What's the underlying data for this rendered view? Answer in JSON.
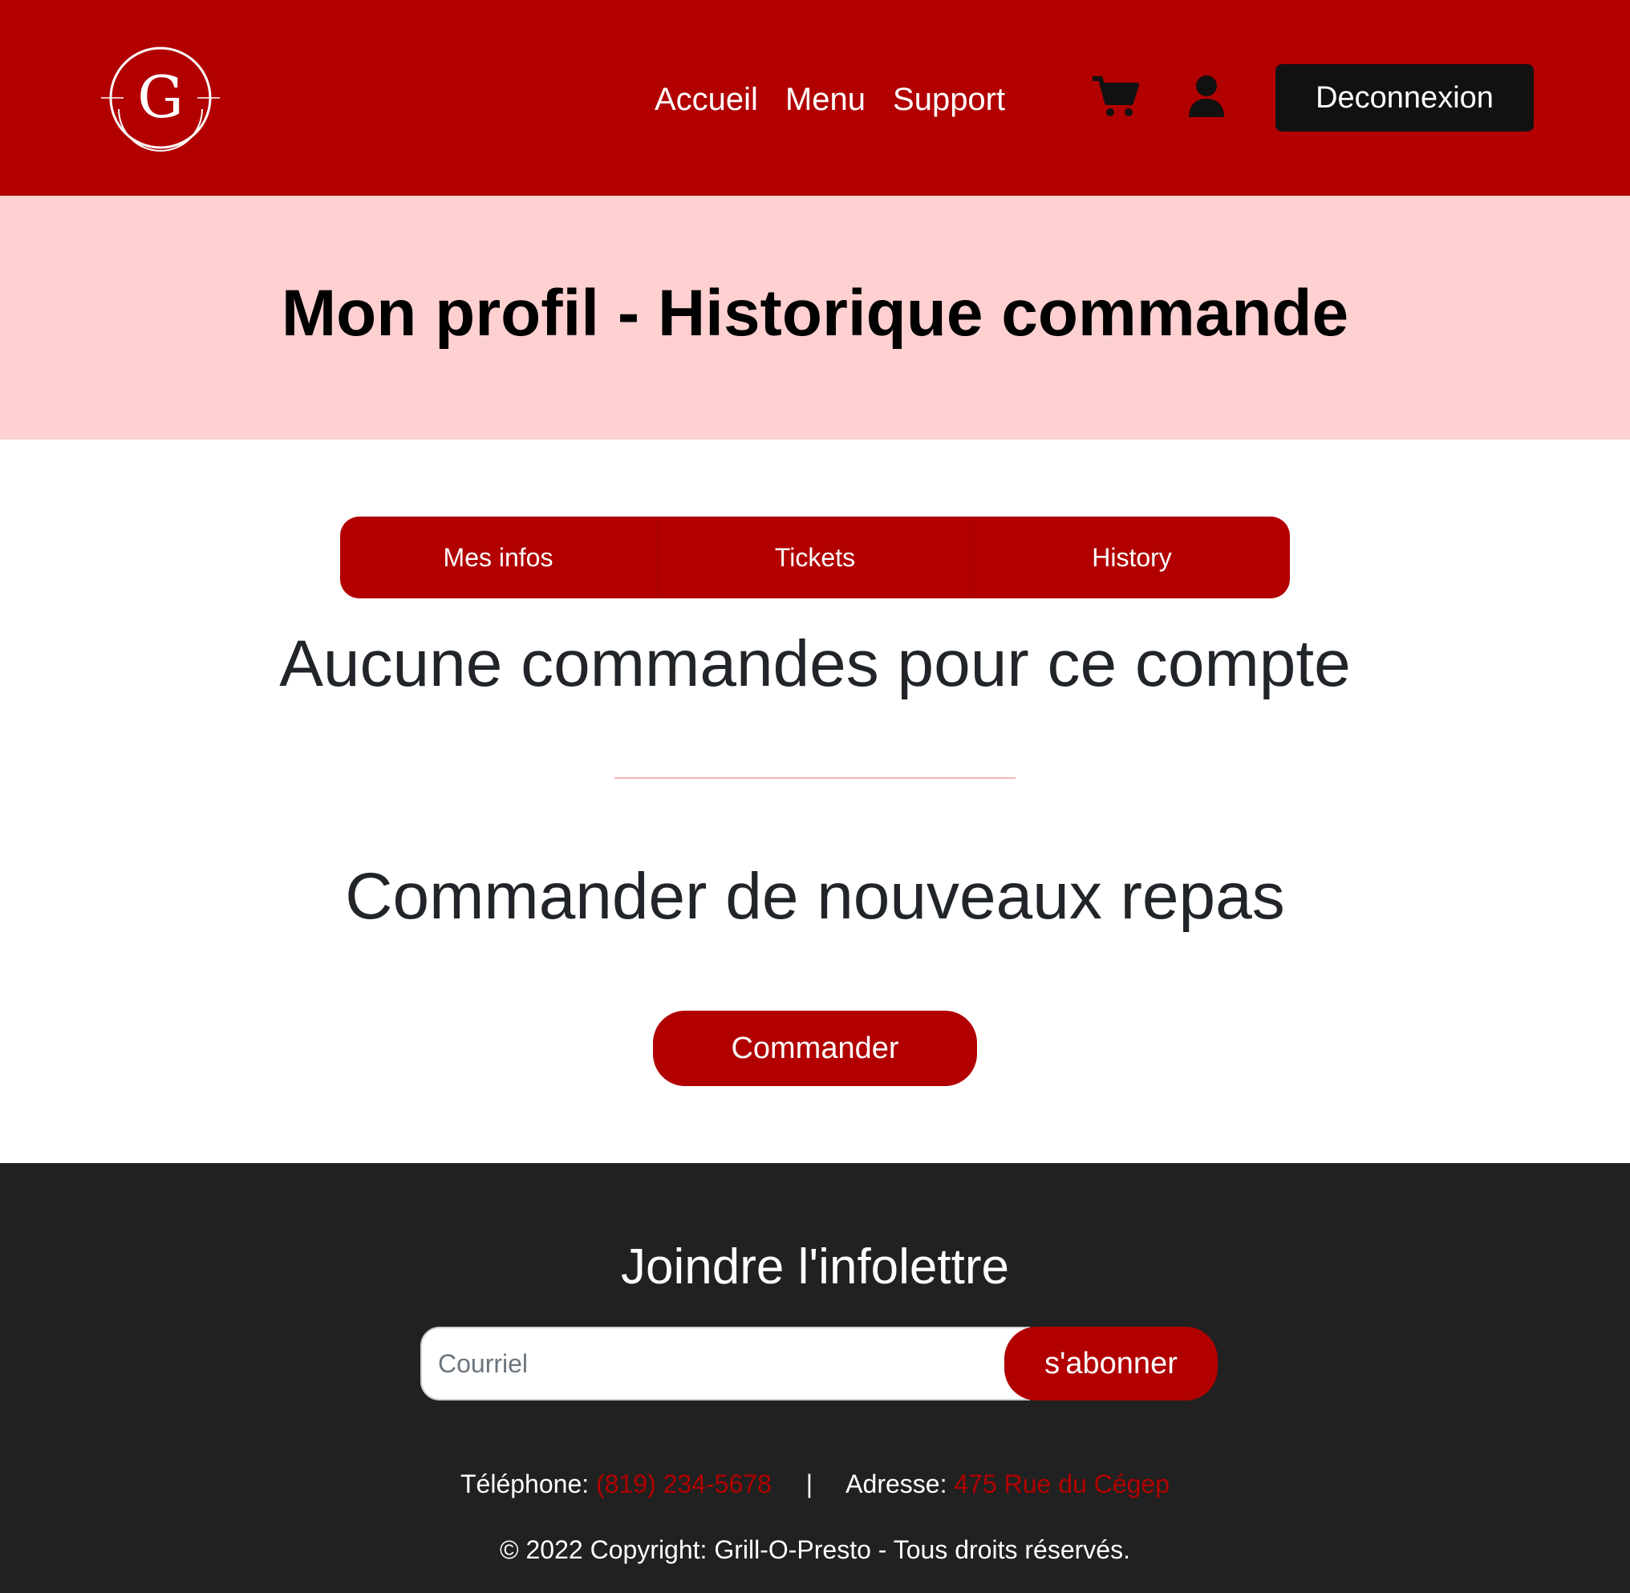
{
  "colors": {
    "brand": "#b20000",
    "hero_bg": "#ffd0d0",
    "footer_bg": "#212121",
    "logout_bg": "#111111"
  },
  "header": {
    "logo_letter": "G",
    "nav": [
      "Accueil",
      "Menu",
      "Support"
    ],
    "cart_icon": "cart-icon",
    "user_icon": "user-icon",
    "logout_label": "Deconnexion"
  },
  "hero": {
    "title": "Mon profil - Historique commande"
  },
  "tabs": [
    "Mes infos",
    "Tickets",
    "History"
  ],
  "main": {
    "empty_message": "Aucune commandes pour ce compte",
    "order_heading": "Commander de nouveaux repas",
    "order_button": "Commander"
  },
  "footer": {
    "newsletter_title": "Joindre l'infolettre",
    "email_placeholder": "Courriel",
    "subscribe_label": "s'abonner",
    "phone_label": "Téléphone:",
    "phone": "(819) 234-5678",
    "separator": "|",
    "address_label": "Adresse:",
    "address": "475 Rue du Cégep",
    "copyright": "© 2022 Copyright: Grill-O-Presto - Tous droits réservés."
  }
}
